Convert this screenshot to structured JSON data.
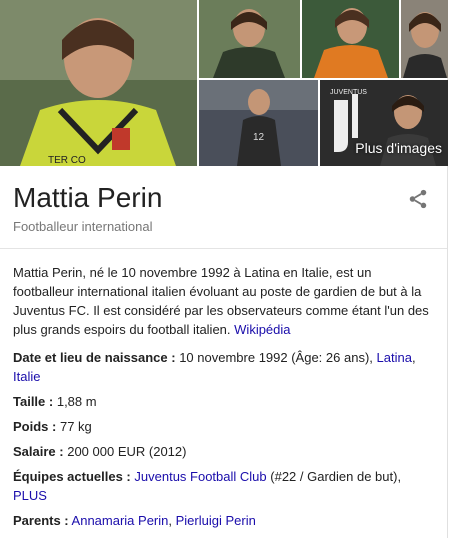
{
  "name": "Mattia Perin",
  "subtitle": "Footballeur international",
  "more_images_label": "Plus d'images",
  "description": {
    "text": "Mattia Perin, né le 10 novembre 1992 à Latina en Italie, est un footballeur international italien évoluant au poste de gardien de but à la Juventus FC. Il est considéré par les observateurs comme étant l'un des plus grands espoirs du football italien.",
    "source": "Wikipédia"
  },
  "facts": {
    "birth": {
      "key": "Date et lieu de naissance :",
      "value": "10 novembre 1992 (Âge: 26 ans),",
      "link1": "Latina",
      "sep": ",",
      "link2": "Italie"
    },
    "height": {
      "key": "Taille :",
      "value": "1,88 m"
    },
    "weight": {
      "key": "Poids :",
      "value": "77 kg"
    },
    "salary": {
      "key": "Salaire :",
      "value": "200 000 EUR (2012)"
    },
    "teams": {
      "key": "Équipes actuelles :",
      "link": "Juventus Football Club",
      "value": "(#22 / Gardien de but),",
      "more": "PLUS"
    },
    "parents": {
      "key": "Parents :",
      "link1": "Annamaria Perin",
      "sep": ",",
      "link2": "Pierluigi Perin"
    }
  },
  "colors": {
    "link": "#1a0dab",
    "title": "#222222",
    "subtitle": "#777777"
  },
  "icons": {
    "share": "share-icon"
  }
}
